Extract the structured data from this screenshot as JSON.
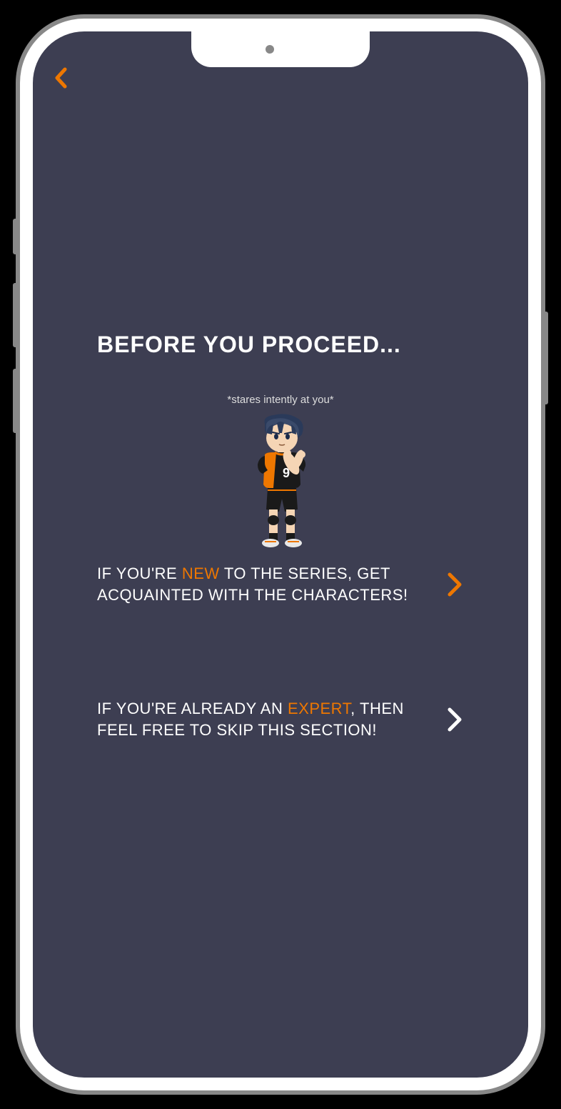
{
  "title": "BEFORE YOU PROCEED...",
  "character": {
    "caption": "*stares intently at you*",
    "jersey_number": "9"
  },
  "options": {
    "new_user": {
      "prefix": "IF YOU'RE ",
      "highlight": "NEW",
      "suffix": " TO THE SERIES, GET ACQUAINTED WITH THE CHARACTERS!"
    },
    "expert_user": {
      "prefix": "IF YOU'RE ALREADY AN ",
      "highlight": "EXPERT",
      "suffix": ", THEN FEEL FREE TO SKIP THIS SECTION!"
    }
  },
  "colors": {
    "accent": "#ee7700",
    "background": "#3d3e52"
  }
}
